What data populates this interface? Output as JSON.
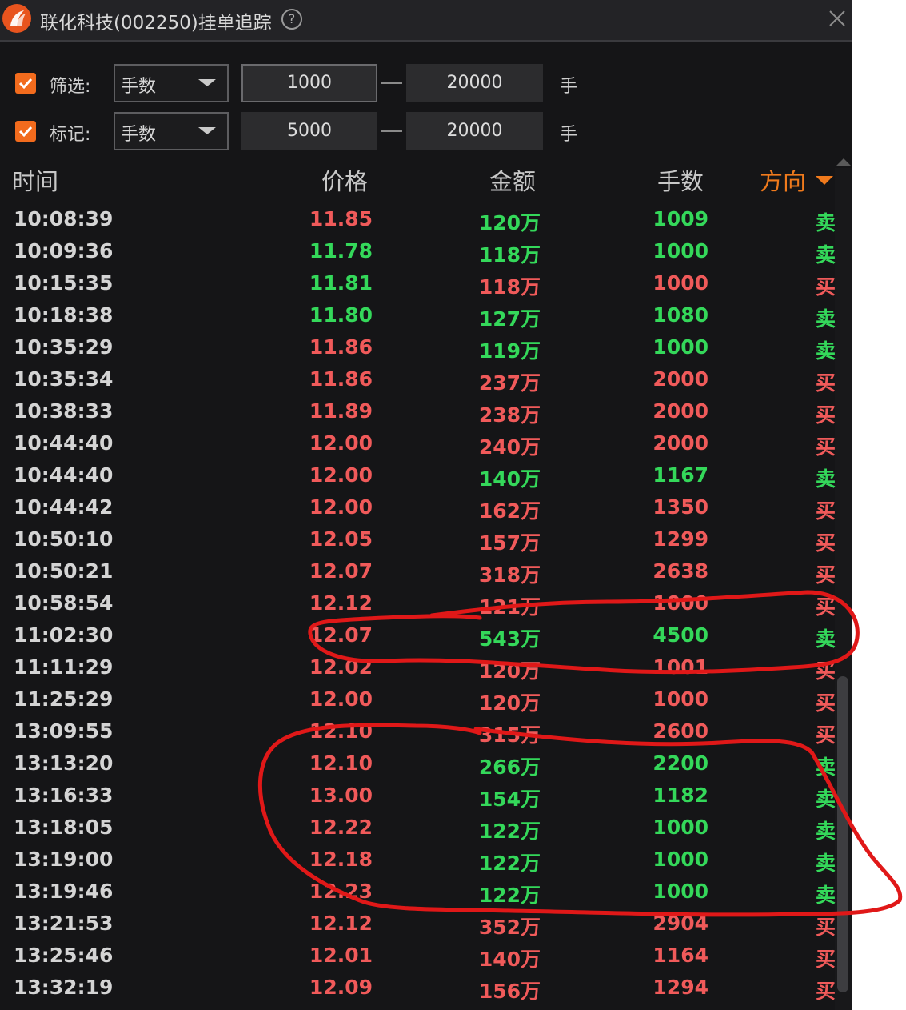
{
  "window": {
    "title": "联化科技(002250)挂单追踪",
    "help_icon": "?",
    "close_icon": "close-icon"
  },
  "filters": [
    {
      "checked": true,
      "label": "筛选:",
      "select_value": "手数",
      "min": "1000",
      "max": "20000",
      "unit": "手"
    },
    {
      "checked": true,
      "label": "标记:",
      "select_value": "手数",
      "min": "5000",
      "max": "20000",
      "unit": "手"
    }
  ],
  "table": {
    "headers": {
      "time": "时间",
      "price": "价格",
      "amount": "金额",
      "volume": "手数",
      "direction": "方向"
    },
    "sort_column": "direction",
    "rows": [
      {
        "time": "10:08:39",
        "price": "11.85",
        "price_color": "red",
        "amount": "120万",
        "volume": "1009",
        "direction": "卖",
        "side_color": "green"
      },
      {
        "time": "10:09:36",
        "price": "11.78",
        "price_color": "green",
        "amount": "118万",
        "volume": "1000",
        "direction": "卖",
        "side_color": "green"
      },
      {
        "time": "10:15:35",
        "price": "11.81",
        "price_color": "green",
        "amount": "118万",
        "volume": "1000",
        "direction": "买",
        "side_color": "red"
      },
      {
        "time": "10:18:38",
        "price": "11.80",
        "price_color": "green",
        "amount": "127万",
        "volume": "1080",
        "direction": "卖",
        "side_color": "green"
      },
      {
        "time": "10:35:29",
        "price": "11.86",
        "price_color": "red",
        "amount": "119万",
        "volume": "1000",
        "direction": "卖",
        "side_color": "green"
      },
      {
        "time": "10:35:34",
        "price": "11.86",
        "price_color": "red",
        "amount": "237万",
        "volume": "2000",
        "direction": "买",
        "side_color": "red"
      },
      {
        "time": "10:38:33",
        "price": "11.89",
        "price_color": "red",
        "amount": "238万",
        "volume": "2000",
        "direction": "买",
        "side_color": "red"
      },
      {
        "time": "10:44:40",
        "price": "12.00",
        "price_color": "red",
        "amount": "240万",
        "volume": "2000",
        "direction": "买",
        "side_color": "red"
      },
      {
        "time": "10:44:40",
        "price": "12.00",
        "price_color": "red",
        "amount": "140万",
        "volume": "1167",
        "direction": "卖",
        "side_color": "green"
      },
      {
        "time": "10:44:42",
        "price": "12.00",
        "price_color": "red",
        "amount": "162万",
        "volume": "1350",
        "direction": "买",
        "side_color": "red"
      },
      {
        "time": "10:50:10",
        "price": "12.05",
        "price_color": "red",
        "amount": "157万",
        "volume": "1299",
        "direction": "买",
        "side_color": "red"
      },
      {
        "time": "10:50:21",
        "price": "12.07",
        "price_color": "red",
        "amount": "318万",
        "volume": "2638",
        "direction": "买",
        "side_color": "red"
      },
      {
        "time": "10:58:54",
        "price": "12.12",
        "price_color": "red",
        "amount": "121万",
        "volume": "1000",
        "direction": "买",
        "side_color": "red"
      },
      {
        "time": "11:02:30",
        "price": "12.07",
        "price_color": "red",
        "amount": "543万",
        "volume": "4500",
        "direction": "卖",
        "side_color": "green"
      },
      {
        "time": "11:11:29",
        "price": "12.02",
        "price_color": "red",
        "amount": "120万",
        "volume": "1001",
        "direction": "买",
        "side_color": "red"
      },
      {
        "time": "11:25:29",
        "price": "12.00",
        "price_color": "red",
        "amount": "120万",
        "volume": "1000",
        "direction": "买",
        "side_color": "red"
      },
      {
        "time": "13:09:55",
        "price": "12.10",
        "price_color": "red",
        "amount": "315万",
        "volume": "2600",
        "direction": "买",
        "side_color": "red"
      },
      {
        "time": "13:13:20",
        "price": "12.10",
        "price_color": "red",
        "amount": "266万",
        "volume": "2200",
        "direction": "卖",
        "side_color": "green"
      },
      {
        "time": "13:16:33",
        "price": "13.00",
        "price_color": "red",
        "amount": "154万",
        "volume": "1182",
        "direction": "卖",
        "side_color": "green"
      },
      {
        "time": "13:18:05",
        "price": "12.22",
        "price_color": "red",
        "amount": "122万",
        "volume": "1000",
        "direction": "卖",
        "side_color": "green"
      },
      {
        "time": "13:19:00",
        "price": "12.18",
        "price_color": "red",
        "amount": "122万",
        "volume": "1000",
        "direction": "卖",
        "side_color": "green"
      },
      {
        "time": "13:19:46",
        "price": "12.23",
        "price_color": "red",
        "amount": "122万",
        "volume": "1000",
        "direction": "卖",
        "side_color": "green"
      },
      {
        "time": "13:21:53",
        "price": "12.12",
        "price_color": "red",
        "amount": "352万",
        "volume": "2904",
        "direction": "买",
        "side_color": "red"
      },
      {
        "time": "13:25:46",
        "price": "12.01",
        "price_color": "red",
        "amount": "140万",
        "volume": "1164",
        "direction": "买",
        "side_color": "red"
      },
      {
        "time": "13:32:19",
        "price": "12.09",
        "price_color": "red",
        "amount": "156万",
        "volume": "1294",
        "direction": "买",
        "side_color": "red"
      }
    ]
  },
  "colors": {
    "up": "#f05a5a",
    "down": "#34d85a",
    "accent": "#f26b1d",
    "annotation": "#e01818"
  }
}
